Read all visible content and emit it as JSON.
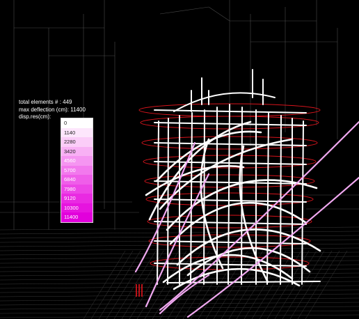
{
  "info": {
    "total_elements": "total elements # : 449",
    "max_deflection": "max deflection (cm): 11400",
    "disp_label": "disp.res(cm):"
  },
  "legend": [
    {
      "label": "0",
      "color": "#ffffff"
    },
    {
      "label": "1140",
      "color": "#fde6fc"
    },
    {
      "label": "2280",
      "color": "#fbcdf8"
    },
    {
      "label": "3420",
      "color": "#f8b0f4"
    },
    {
      "label": "4560",
      "color": "#f595f1"
    },
    {
      "label": "5700",
      "color": "#f279ed"
    },
    {
      "label": "6840",
      "color": "#ef5ee9"
    },
    {
      "label": "7980",
      "color": "#ec45e6"
    },
    {
      "label": "9120",
      "color": "#e92ae2"
    },
    {
      "label": "10300",
      "color": "#e614df"
    },
    {
      "label": "11400",
      "color": "#e200dc"
    }
  ],
  "colors": {
    "background": "#000000",
    "structure": "#ffffff",
    "floor_rings": "#d8141c",
    "deflected": "#f0a8f0",
    "wireframe": "#5a5a5a"
  },
  "model": {
    "view": "3d-perspective",
    "element_count": 449,
    "max_deflection_cm": 11400
  }
}
